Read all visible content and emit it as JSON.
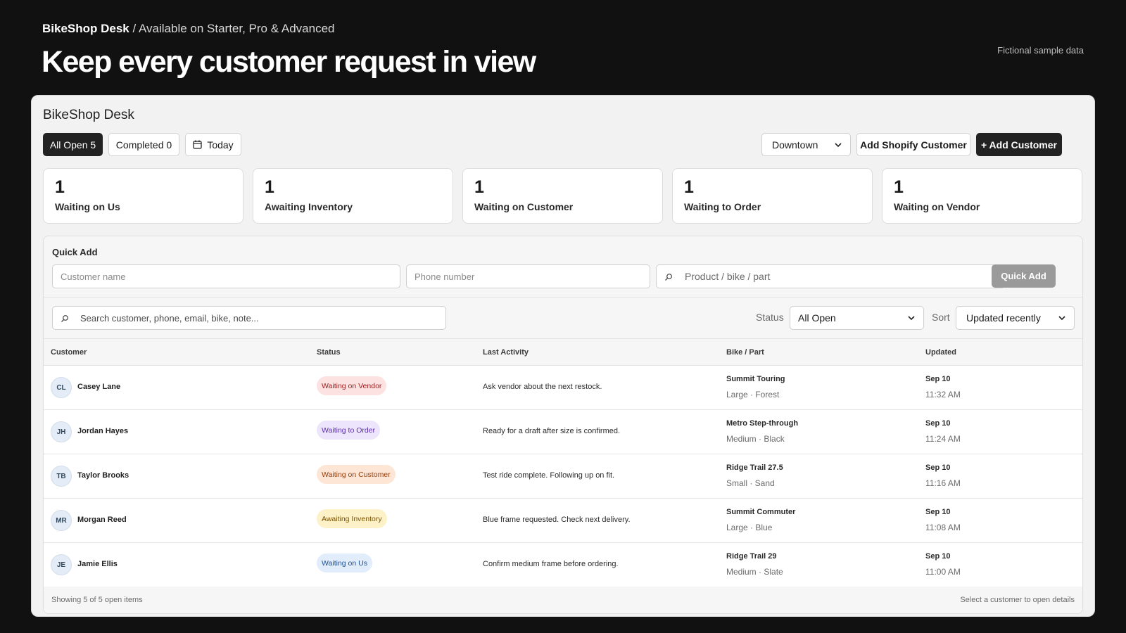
{
  "hero": {
    "brand": "BikeShop Desk",
    "plans": " / Available on Starter, Pro & Advanced",
    "title": "Keep every customer request in view",
    "note": "Fictional sample data"
  },
  "app": {
    "title": "BikeShop Desk",
    "tabs": {
      "all_open": "All Open 5",
      "completed": "Completed 0",
      "today": "Today"
    },
    "location": "Downtown",
    "add_shopify": "Add Shopify Customer",
    "add_customer": "+ Add Customer"
  },
  "stats": [
    {
      "value": "1",
      "label": "Waiting on Us"
    },
    {
      "value": "1",
      "label": "Awaiting Inventory"
    },
    {
      "value": "1",
      "label": "Waiting on Customer"
    },
    {
      "value": "1",
      "label": "Waiting to Order"
    },
    {
      "value": "1",
      "label": "Waiting on Vendor"
    }
  ],
  "quick_add": {
    "title": "Quick Add",
    "name_placeholder": "Customer name",
    "phone_placeholder": "Phone number",
    "product_placeholder": "Product / bike / part",
    "button": "Quick Add"
  },
  "filters": {
    "search_placeholder": "Search customer, phone, email, bike, note...",
    "status_label": "Status",
    "status_value": "All Open",
    "sort_label": "Sort",
    "sort_value": "Updated recently"
  },
  "table": {
    "headers": {
      "customer": "Customer",
      "status": "Status",
      "activity": "Last Activity",
      "bike": "Bike / Part",
      "updated": "Updated"
    },
    "rows": [
      {
        "initials": "CL",
        "name": "Casey Lane",
        "status": "Waiting on Vendor",
        "activity": "Ask vendor about the next restock.",
        "bike": "Summit Touring",
        "bike_detail": "Large · Forest",
        "date": "Sep 10",
        "time": "11:32 AM"
      },
      {
        "initials": "JH",
        "name": "Jordan Hayes",
        "status": "Waiting to Order",
        "activity": "Ready for a draft after size is confirmed.",
        "bike": "Metro Step-through",
        "bike_detail": "Medium · Black",
        "date": "Sep 10",
        "time": "11:24 AM"
      },
      {
        "initials": "TB",
        "name": "Taylor Brooks",
        "status": "Waiting on Customer",
        "activity": "Test ride complete. Following up on fit.",
        "bike": "Ridge Trail 27.5",
        "bike_detail": "Small · Sand",
        "date": "Sep 10",
        "time": "11:16 AM"
      },
      {
        "initials": "MR",
        "name": "Morgan Reed",
        "status": "Awaiting Inventory",
        "activity": "Blue frame requested. Check next delivery.",
        "bike": "Summit Commuter",
        "bike_detail": "Large · Blue",
        "date": "Sep 10",
        "time": "11:08 AM"
      },
      {
        "initials": "JE",
        "name": "Jamie Ellis",
        "status": "Waiting on Us",
        "activity": "Confirm medium frame before ordering.",
        "bike": "Ridge Trail 29",
        "bike_detail": "Medium · Slate",
        "date": "Sep 10",
        "time": "11:00 AM"
      }
    ]
  },
  "footer": {
    "count": "Showing 5 of 5 open items",
    "hint": "Select a customer to open details"
  },
  "colors": {
    "page_bg": "#111111",
    "badge_vendor": "#fde2e2",
    "badge_order": "#ece5fb",
    "badge_customer": "#fde6d6",
    "badge_inventory": "#fdf1c7",
    "badge_us": "#e1edfb"
  }
}
